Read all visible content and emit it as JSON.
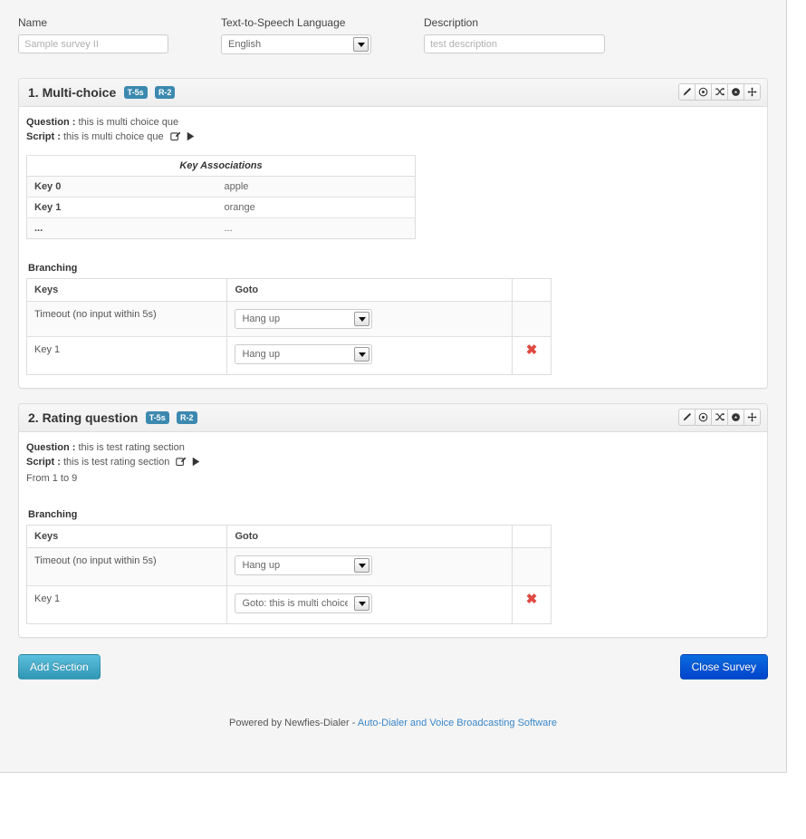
{
  "form": {
    "name": {
      "label": "Name",
      "value": "Sample survey II"
    },
    "tts": {
      "label": "Text-to-Speech Language",
      "value": "English"
    },
    "description": {
      "label": "Description",
      "value": "test description"
    }
  },
  "labels": {
    "question_prefix": "Question :",
    "script_prefix": "Script :",
    "branching": "Branching",
    "key_associations": "Key Associations",
    "col_keys": "Keys",
    "col_goto": "Goto"
  },
  "sections": [
    {
      "title": "1. Multi-choice",
      "badge_timeout": "T-5s",
      "badge_retries": "R-2",
      "question": "this is multi choice que",
      "script": "this is multi choice que",
      "range_text": "",
      "key_associations": {
        "title": "Key Associations",
        "rows": [
          {
            "key": "Key 0",
            "value": "apple"
          },
          {
            "key": "Key 1",
            "value": "orange"
          },
          {
            "key": "...",
            "value": "..."
          }
        ]
      },
      "branching": {
        "rows": [
          {
            "key": "Timeout (no input within 5s)",
            "goto": "Hang up",
            "deletable": false
          },
          {
            "key": "Key  1",
            "goto": "Hang up",
            "deletable": true
          }
        ]
      }
    },
    {
      "title": "2. Rating question",
      "badge_timeout": "T-5s",
      "badge_retries": "R-2",
      "question": "this is test rating section",
      "script": "this is test rating section",
      "range_text": "From 1 to 9",
      "branching": {
        "rows": [
          {
            "key": "Timeout (no input within 5s)",
            "goto": "Hang up",
            "deletable": false
          },
          {
            "key": "Key  1",
            "goto": "Goto: this is multi choice que",
            "deletable": true
          }
        ]
      }
    }
  ],
  "buttons": {
    "add_section": "Add Section",
    "close_survey": "Close Survey"
  },
  "footer": {
    "powered_text": "Powered by Newfies-Dialer - ",
    "link_text": "Auto-Dialer and Voice Broadcasting Software"
  },
  "colors": {
    "badge": "#3c89b0",
    "link": "#3a87c8",
    "delete": "#e04a42",
    "btn_info": "#2f96b4",
    "btn_primary": "#0044cc"
  }
}
